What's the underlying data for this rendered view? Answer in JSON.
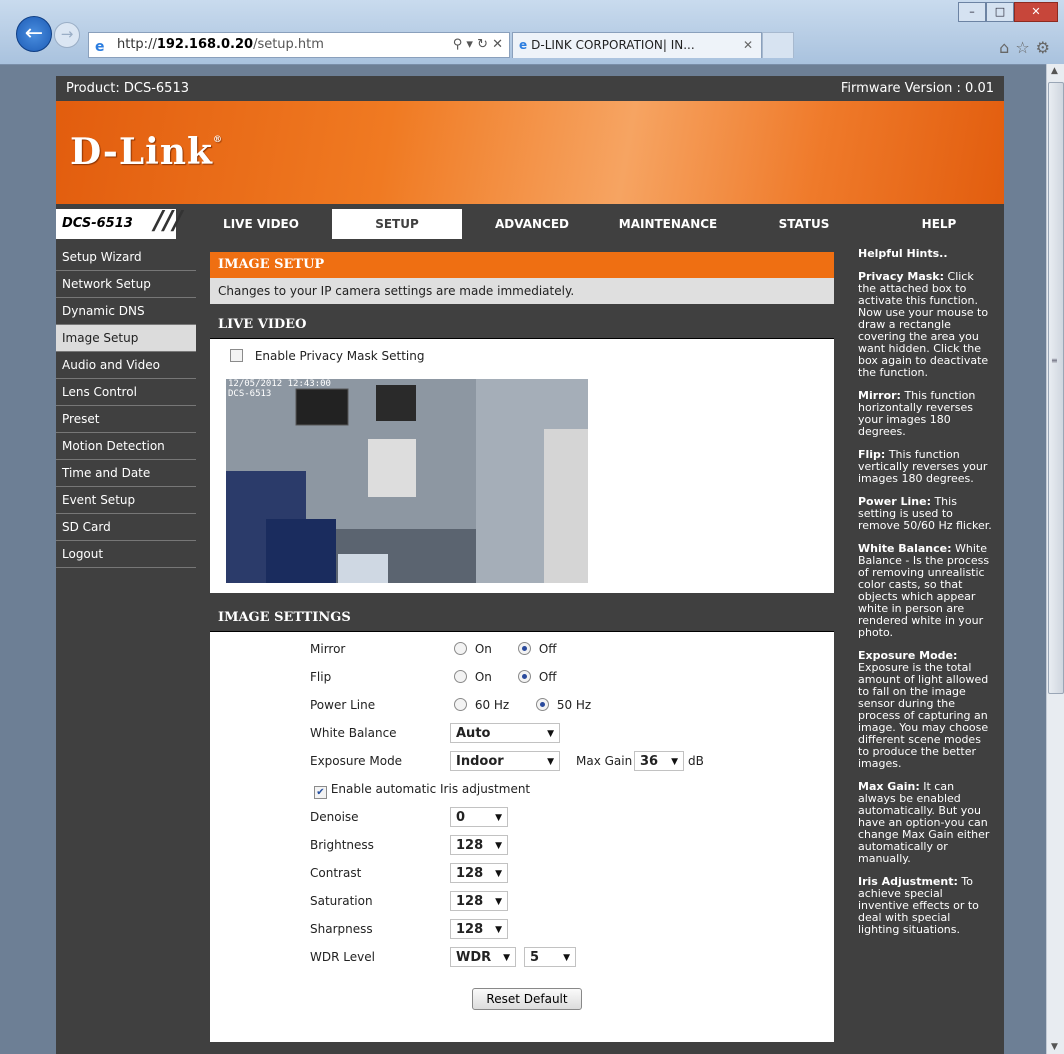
{
  "browser": {
    "url_host_prefix": "http://",
    "url_host": "192.168.0.20",
    "url_path": "/setup.htm",
    "tab_title": "D-LINK CORPORATION| IN...",
    "addr_controls": "⚲ ▾ ↻ ✕"
  },
  "header": {
    "product": "Product: DCS-6513",
    "firmware": "Firmware Version : 0.01",
    "logo": "D-Link",
    "model_badge": "DCS-6513",
    "slashes": "///"
  },
  "nav": {
    "tabs": [
      {
        "label": "LIVE VIDEO"
      },
      {
        "label": "SETUP"
      },
      {
        "label": "ADVANCED"
      },
      {
        "label": "MAINTENANCE"
      },
      {
        "label": "STATUS"
      },
      {
        "label": "HELP"
      }
    ],
    "active": "SETUP"
  },
  "sidebar": {
    "items": [
      {
        "label": "Setup Wizard"
      },
      {
        "label": "Network Setup"
      },
      {
        "label": "Dynamic DNS"
      },
      {
        "label": "Image Setup"
      },
      {
        "label": "Audio and Video"
      },
      {
        "label": "Lens Control"
      },
      {
        "label": "Preset"
      },
      {
        "label": "Motion Detection"
      },
      {
        "label": "Time and Date"
      },
      {
        "label": "Event Setup"
      },
      {
        "label": "SD Card"
      },
      {
        "label": "Logout"
      }
    ],
    "active": "Image Setup"
  },
  "image_setup": {
    "title": "IMAGE SETUP",
    "note": "Changes to your IP camera settings are made immediately."
  },
  "live_video": {
    "title": "LIVE VIDEO",
    "privacy_label": "Enable Privacy Mask Setting",
    "privacy_checked": false,
    "timestamp": "12/05/2012 12:43:00",
    "cam_name": "DCS-6513"
  },
  "image_settings": {
    "title": "IMAGE SETTINGS",
    "mirror": {
      "label": "Mirror",
      "opt1": "On",
      "opt2": "Off",
      "selected": "Off"
    },
    "flip": {
      "label": "Flip",
      "opt1": "On",
      "opt2": "Off",
      "selected": "Off"
    },
    "power_line": {
      "label": "Power Line",
      "opt1": "60 Hz",
      "opt2": "50 Hz",
      "selected": "50 Hz"
    },
    "white_balance": {
      "label": "White Balance",
      "value": "Auto"
    },
    "exposure_mode": {
      "label": "Exposure Mode",
      "value": "Indoor"
    },
    "max_gain": {
      "label": "Max Gain",
      "value": "36",
      "unit": "dB"
    },
    "iris": {
      "label": "Enable automatic Iris adjustment",
      "checked": true
    },
    "denoise": {
      "label": "Denoise",
      "value": "0"
    },
    "brightness": {
      "label": "Brightness",
      "value": "128"
    },
    "contrast": {
      "label": "Contrast",
      "value": "128"
    },
    "saturation": {
      "label": "Saturation",
      "value": "128"
    },
    "sharpness": {
      "label": "Sharpness",
      "value": "128"
    },
    "wdr": {
      "label": "WDR Level",
      "value": "WDR",
      "level": "5"
    },
    "reset_label": "Reset Default"
  },
  "hints": {
    "title": "Helpful Hints..",
    "items": [
      {
        "term": "Privacy Mask:",
        "text": " Click the attached box to activate this function. Now use your mouse to draw a rectangle covering the area you want hidden. Click the box again to deactivate the function."
      },
      {
        "term": "Mirror:",
        "text": " This function horizontally reverses your images 180 degrees."
      },
      {
        "term": "Flip:",
        "text": " This function vertically reverses your images 180 degrees."
      },
      {
        "term": "Power Line:",
        "text": " This setting is used to remove 50/60 Hz flicker."
      },
      {
        "term": "White Balance:",
        "text": " White Balance - Is the process of removing unrealistic color casts, so that objects which appear white in person are rendered white in your photo."
      },
      {
        "term": "Exposure Mode:",
        "text": " Exposure is the total amount of light allowed to fall on the image sensor during the process of capturing an image. You may choose different scene modes to produce the better images."
      },
      {
        "term": "Max Gain:",
        "text": " It can always be enabled automatically. But you have an option-you can change Max Gain either automatically or manually."
      },
      {
        "term": "Iris Adjustment:",
        "text": " To achieve special inventive effects or to deal with special lighting situations."
      }
    ]
  },
  "colors": {
    "accent": "#ef6f12",
    "panel": "#404040"
  }
}
